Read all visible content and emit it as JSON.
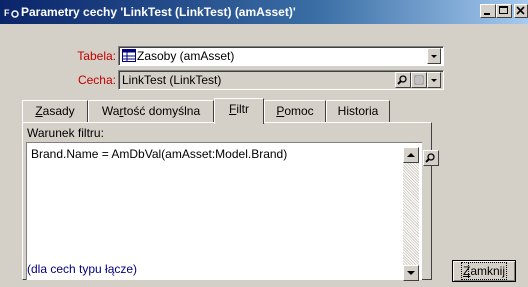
{
  "window": {
    "title": "Parametry cechy 'LinkTest (LinkTest) (amAsset)'",
    "title_icon": "properties-icon"
  },
  "form": {
    "table_label": "Tabela:",
    "table_value": "Zasoby (amAsset)",
    "feature_label": "Cecha:",
    "feature_value": "LinkTest (LinkTest)"
  },
  "tabs": [
    {
      "label": "Zasady",
      "accel": "Z",
      "rest": "asady"
    },
    {
      "label": "Wartość domyślna",
      "accel": "r",
      "prefix": "Wa",
      "rest": "tość domyślna"
    },
    {
      "label": "Filtr",
      "accel": "F",
      "rest": "iltr",
      "active": true
    },
    {
      "label": "Pomoc",
      "accel": "P",
      "rest": "omoc"
    },
    {
      "label": "Historia"
    }
  ],
  "filter_panel": {
    "label": "Warunek filtru:",
    "expression": "Brand.Name = AmDbVal(amAsset:Model.Brand)",
    "help": "(dla cech typu łącze)"
  },
  "buttons": {
    "close": "Zamknij",
    "close_accel": "Z",
    "close_rest": "amknij"
  },
  "colors": {
    "titlebar": "#0a246a",
    "label_red": "#c00000",
    "help_blue": "#000080",
    "face": "#d4d0c8"
  }
}
